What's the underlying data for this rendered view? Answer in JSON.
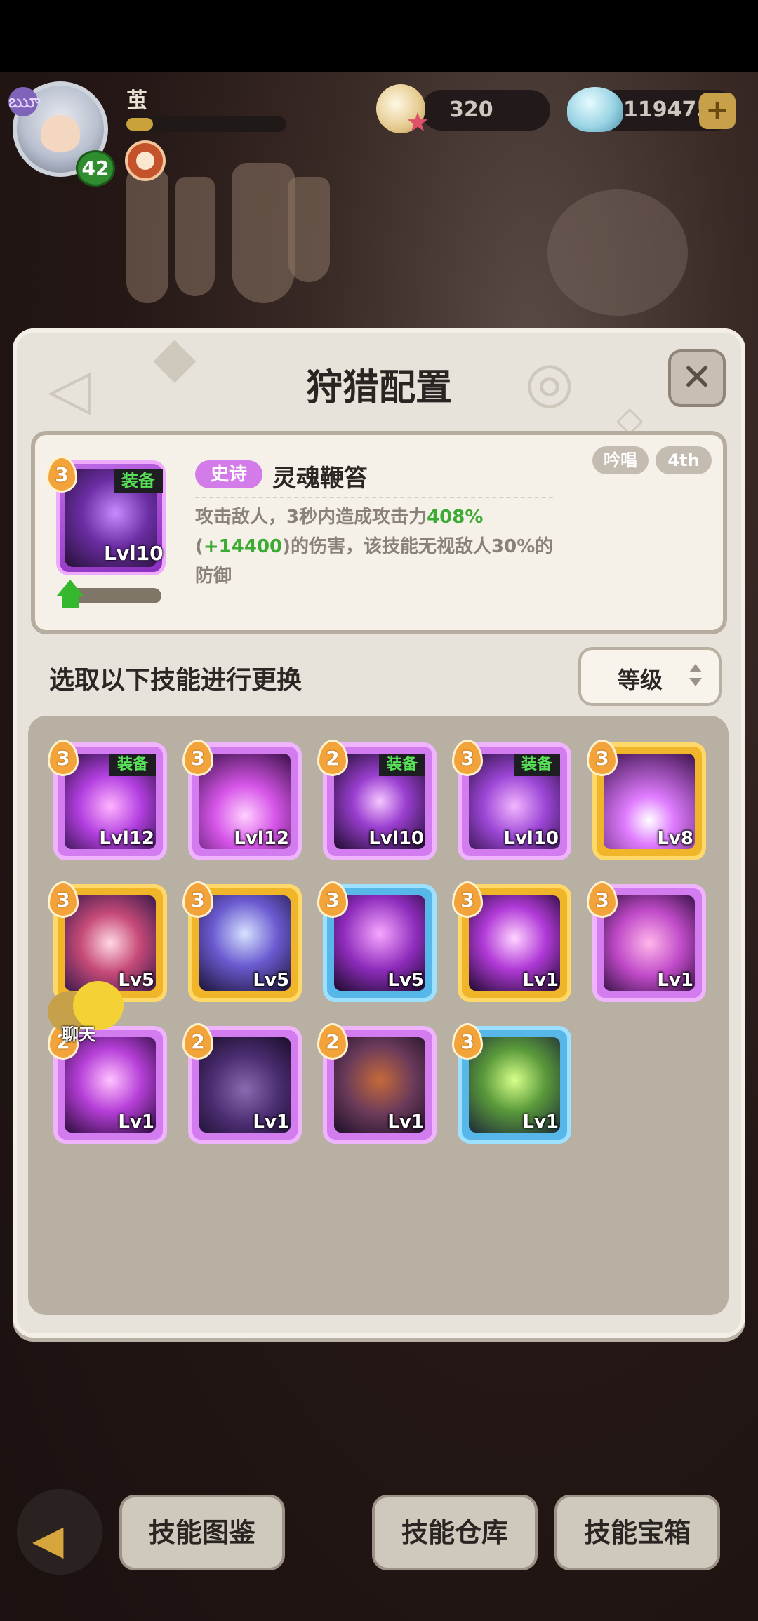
{
  "player": {
    "name": "茧",
    "level": "42",
    "xp_progress": 0.17
  },
  "resources": {
    "pearls": "320",
    "gems": "119475",
    "add_label": "+"
  },
  "panel": {
    "title": "狩猎配置",
    "close_label": "✕"
  },
  "selected_skill": {
    "cost": "3",
    "equipped_label": "装备",
    "level": "Lvl10",
    "rarity": "史诗",
    "name": "灵魂鞭笞",
    "tag_cast": "吟唱",
    "tag_slot": "4th",
    "desc_part1": "攻击敌人，3秒内造成攻击力",
    "desc_highlight1": "408%",
    "desc_part2": "(",
    "desc_highlight2": "+14400",
    "desc_part3": ")的伤害，该技能无视敌人30%的防御",
    "upgrade_progress": 0.0
  },
  "replace": {
    "prompt": "选取以下技能进行更换",
    "sort_label": "等级"
  },
  "skills": [
    {
      "cost": "3",
      "level": "Lvl12",
      "equipped": "装备",
      "rarity": "epic",
      "art": "cross-flame-icon"
    },
    {
      "cost": "3",
      "level": "Lvl12",
      "equipped": "",
      "rarity": "epic",
      "art": "pink-explosion-icon"
    },
    {
      "cost": "2",
      "level": "Lvl10",
      "equipped": "装备",
      "rarity": "epic",
      "art": "vortex-flame-icon"
    },
    {
      "cost": "3",
      "level": "Lvl10",
      "equipped": "装备",
      "rarity": "epic",
      "art": "spiral-flame-icon"
    },
    {
      "cost": "3",
      "level": "Lv8",
      "equipped": "",
      "rarity": "legend",
      "art": "claw-burst-icon"
    },
    {
      "cost": "3",
      "level": "Lv5",
      "equipped": "",
      "rarity": "legend",
      "art": "priestess-icon"
    },
    {
      "cost": "3",
      "level": "Lv5",
      "equipped": "",
      "rarity": "legend",
      "art": "lightning-scythe-icon"
    },
    {
      "cost": "3",
      "level": "Lv5",
      "equipped": "",
      "rarity": "rare",
      "art": "shadow-demon-icon"
    },
    {
      "cost": "3",
      "level": "Lv1",
      "equipped": "",
      "rarity": "legend",
      "art": "flame-skull-icon"
    },
    {
      "cost": "3",
      "level": "Lv1",
      "equipped": "",
      "rarity": "epic",
      "art": "pink-frog-icon"
    },
    {
      "cost": "2",
      "level": "Lv1",
      "equipped": "",
      "rarity": "epic",
      "art": "heal-swirl-icon"
    },
    {
      "cost": "2",
      "level": "Lv1",
      "equipped": "",
      "rarity": "epic",
      "art": "dark-frog-icon"
    },
    {
      "cost": "2",
      "level": "Lv1",
      "equipped": "",
      "rarity": "epic",
      "art": "angry-toad-icon"
    },
    {
      "cost": "3",
      "level": "Lv1",
      "equipped": "",
      "rarity": "rare",
      "art": "egg-frog-icon"
    }
  ],
  "chat": {
    "label": "聊天"
  },
  "bottom_nav": {
    "back_icon": "back-arrow-icon",
    "codex": "技能图鉴",
    "warehouse": "技能仓库",
    "chest": "技能宝箱"
  },
  "colors": {
    "epic": "#d27cf0",
    "legend": "#f1b52a",
    "rare": "#56b7e8",
    "equip_text": "#57e157",
    "highlight_green": "#3cab33"
  }
}
